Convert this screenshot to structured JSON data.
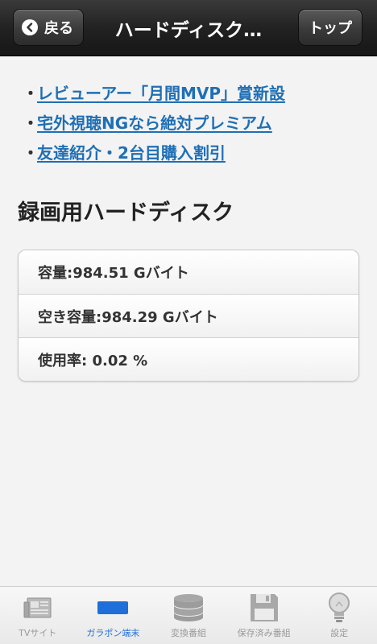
{
  "navbar": {
    "back_label": "戻る",
    "title": "ハードディスク…",
    "top_label": "トップ"
  },
  "links": [
    {
      "bullet": "・",
      "text": "レビューアー「月間MVP」賞新設"
    },
    {
      "bullet": "・",
      "text": "宅外視聴NGなら絶対プレミアム"
    },
    {
      "bullet": "・",
      "text": "友達紹介・2台目購入割引"
    }
  ],
  "section": {
    "heading": "録画用ハードディスク",
    "rows": [
      {
        "text": "容量:984.51 Gバイト"
      },
      {
        "text": "空き容量:984.29 Gバイト"
      },
      {
        "text": "使用率: 0.02 %"
      }
    ]
  },
  "tabbar": {
    "items": [
      {
        "label": "TVサイト",
        "icon": "newspaper-icon",
        "active": false
      },
      {
        "label": "ガラポン端末",
        "icon": "device-icon",
        "active": true
      },
      {
        "label": "変換番組",
        "icon": "database-icon",
        "active": false
      },
      {
        "label": "保存済み番組",
        "icon": "floppy-icon",
        "active": false
      },
      {
        "label": "設定",
        "icon": "lightbulb-icon",
        "active": false
      }
    ]
  },
  "colors": {
    "link": "#1f6fb5",
    "active_tab": "#1e6fd9",
    "navbar": "#222222"
  }
}
